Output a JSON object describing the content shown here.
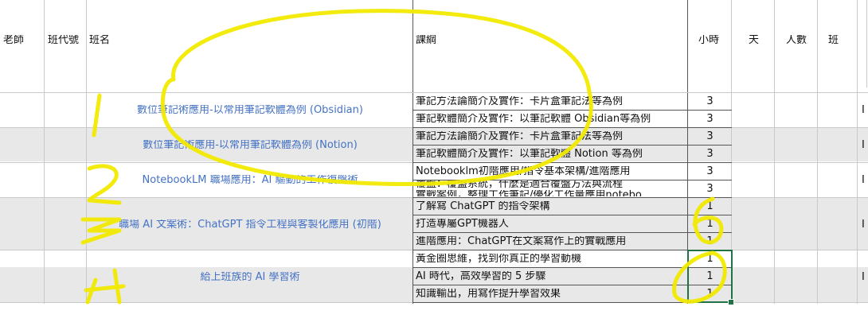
{
  "headers": {
    "teacher": "老師",
    "class_code": "班代號",
    "class_name": "班名",
    "syllabus": "課綱",
    "hours": "小時",
    "days": "天",
    "count": "人數",
    "shift": "班"
  },
  "groups": [
    {
      "class_name": "數位筆記術應用-以常用筆記軟體為例 (Obsidian)",
      "rows": [
        {
          "syllabus": "筆記方法論簡介及實作：卡片盒筆記法等為例",
          "hours": "3"
        },
        {
          "syllabus": "筆記軟體簡介及實作：以筆記軟體 Obsidian等為例",
          "hours": "3"
        }
      ]
    },
    {
      "class_name": "數位筆記術應用-以常用筆記軟體為例 (Notion)",
      "rows": [
        {
          "syllabus": "筆記方法論簡介及實作：卡片盒筆記法等為例",
          "hours": "3"
        },
        {
          "syllabus": "筆記軟體簡介及實作：以筆記軟體 Notion 等為例",
          "hours": "3"
        }
      ]
    },
    {
      "class_name": "NotebookLM 職場應用：AI 驅動的工作復盤術",
      "rows": [
        {
          "syllabus": "Notebooklm初階應用/指令基本架構/進階應用",
          "hours": "3"
        },
        {
          "syllabus": "覆盤：覆盤系統，什麼是適合覆盤方法與流程",
          "hours": "3"
        },
        {
          "syllabus": "實戰案例，整理工作筆記/優化工作量應用notebo",
          "hours": ""
        }
      ]
    },
    {
      "class_name": "職場 AI 文案術：ChatGPT 指令工程與客製化應用 (初階)",
      "rows": [
        {
          "syllabus": "了解寫 ChatGPT 的指令架構",
          "hours": "1"
        },
        {
          "syllabus": "打造專屬GPT機器人",
          "hours": "1"
        },
        {
          "syllabus": "進階應用：ChatGPT在文案寫作上的實戰應用",
          "hours": "1"
        }
      ]
    },
    {
      "class_name": "給上班族的 AI 學習術",
      "rows": [
        {
          "syllabus": "黃金圈思維，找到你真正的學習動機",
          "hours": "1"
        },
        {
          "syllabus": "AI 時代，高效學習的 5 步驟",
          "hours": "1"
        },
        {
          "syllabus": "知識輸出，用寫作提升學習效果",
          "hours": "1"
        }
      ]
    }
  ],
  "edge": {
    "right_col_char": "I"
  },
  "colors": {
    "class_name_text": "#4472c4",
    "row_band": "#e8e8e8",
    "selection": "#217346",
    "highlighter": "#f2ea00"
  }
}
